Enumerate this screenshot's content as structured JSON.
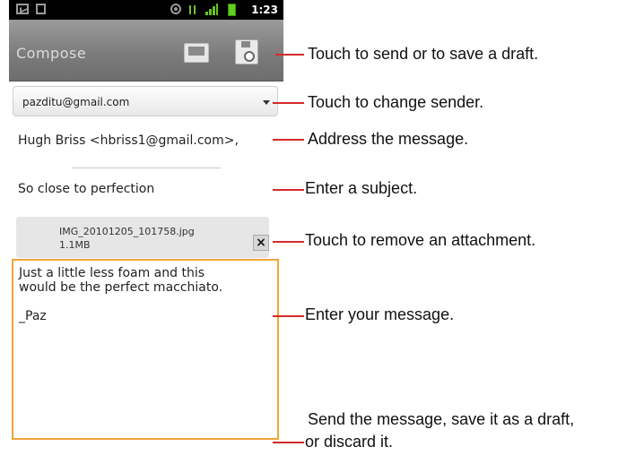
{
  "status_bar": {
    "time": "1:23",
    "icons": [
      "email-notification-icon",
      "sd-card-icon",
      "gps-icon",
      "data-activity-icon",
      "signal-icon",
      "battery-icon"
    ]
  },
  "title_bar": {
    "title": "Compose",
    "send_icon": "send-tray-icon",
    "save_icon": "save-draft-icon"
  },
  "sender": {
    "value": "pazditu@gmail.com"
  },
  "to": {
    "value": "Hugh Briss <hbriss1@gmail.com>,"
  },
  "subject": {
    "value": "So close to perfection"
  },
  "attachment": {
    "name": "IMG_20101205_101758.jpg",
    "size": "1.1MB",
    "remove_label": "×"
  },
  "body": {
    "value": "Just a little less foam and this\nwould be the perfect macchiato.\n\n_Paz"
  },
  "annotations": [
    {
      "text": "Touch to send or to save a draft."
    },
    {
      "text": "Touch to change sender."
    },
    {
      "text": "Address the message."
    },
    {
      "text": "Enter a subject."
    },
    {
      "text": "Touch to remove an attachment."
    },
    {
      "text": "Enter your message."
    },
    {
      "line1": "Send the message, save it as a draft,",
      "line2": "or discard it."
    }
  ],
  "colors": {
    "callout": "#d42a2a",
    "focus_border": "#f0a43a",
    "title_bar": "#7a7a7a"
  }
}
